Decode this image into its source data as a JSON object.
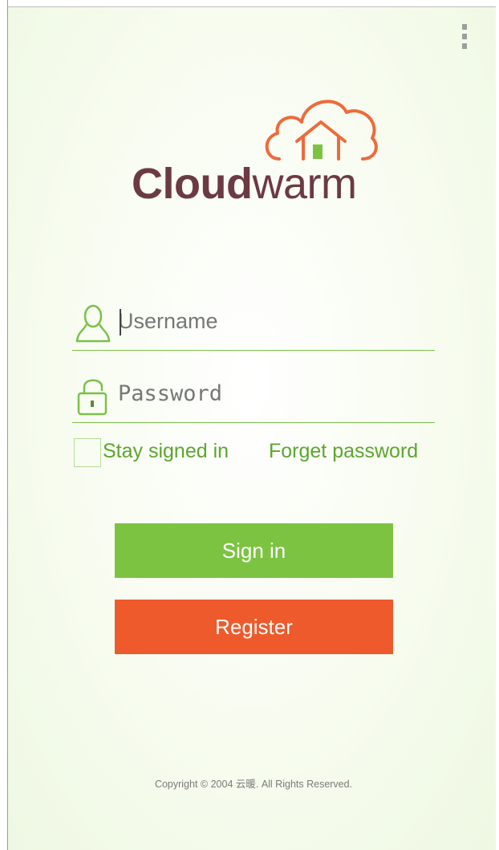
{
  "menu": {
    "icon": "overflow-menu-icon"
  },
  "logo": {
    "icon": "cloud-house-icon",
    "text_bold": "Cloud",
    "text_regular": "warm",
    "colors": {
      "cloud": "#ee6a3b",
      "door": "#7dc342",
      "text": "#6c3a43"
    }
  },
  "form": {
    "username": {
      "placeholder": "Username",
      "value": "",
      "icon": "user-icon"
    },
    "password": {
      "placeholder": "Password",
      "value": "",
      "icon": "lock-icon"
    },
    "stay_signed_in": {
      "label": "Stay signed in",
      "checked": false
    },
    "forget_password": "Forget password"
  },
  "buttons": {
    "sign_in": "Sign in",
    "register": "Register"
  },
  "colors": {
    "accent_green": "#7dc342",
    "accent_orange": "#ee5a2b",
    "link_green": "#5ca62e"
  },
  "footer": {
    "copyright": "Copyright © 2004 云暖. All Rights Reserved."
  }
}
